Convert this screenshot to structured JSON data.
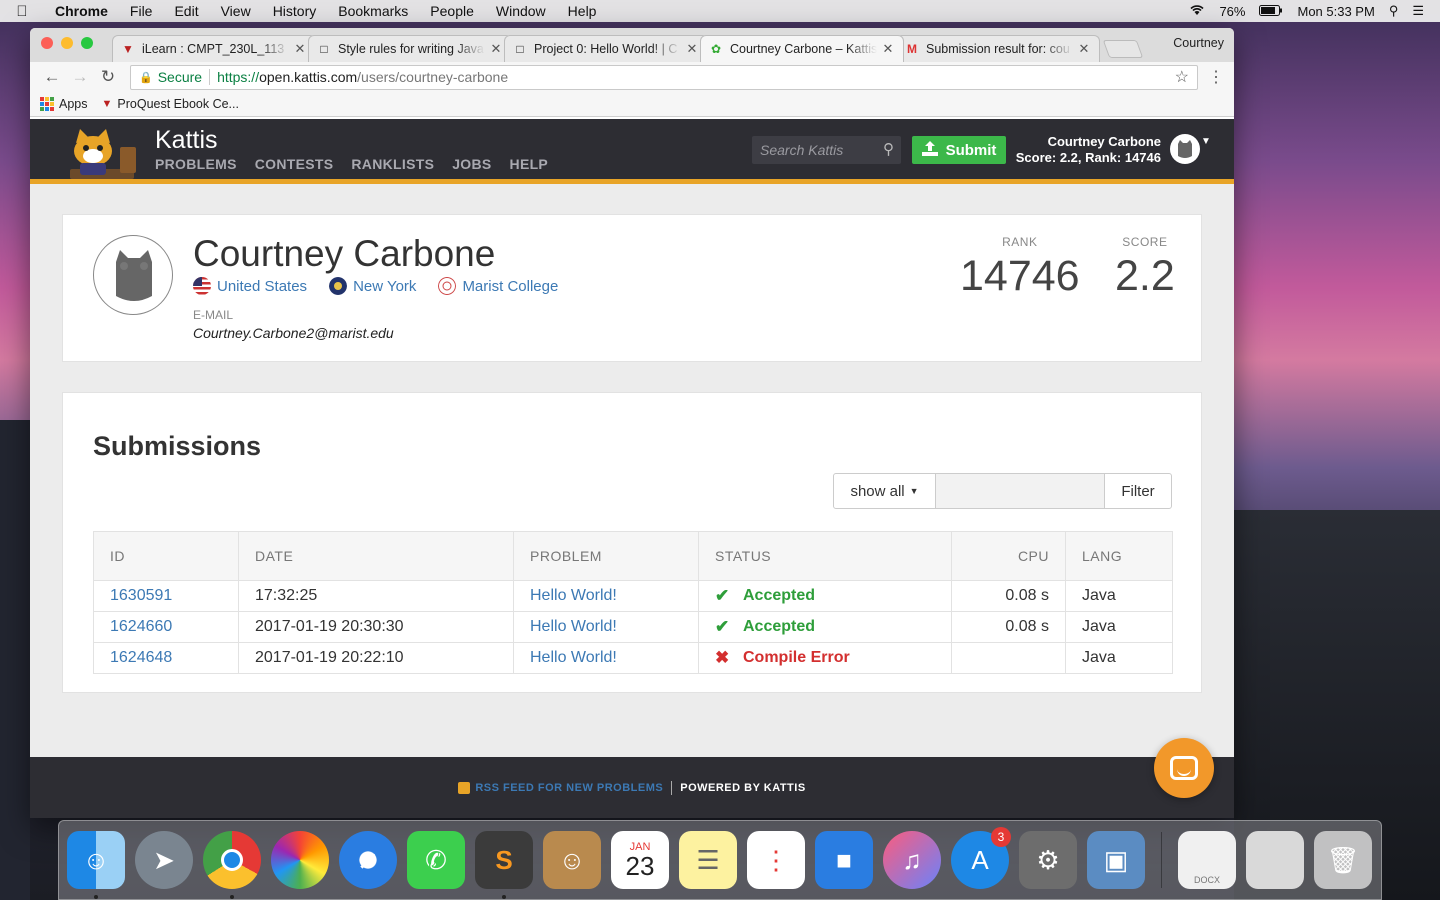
{
  "menubar": {
    "items": [
      "Chrome",
      "File",
      "Edit",
      "View",
      "History",
      "Bookmarks",
      "People",
      "Window",
      "Help"
    ],
    "battery": "76%",
    "clock": "Mon 5:33 PM"
  },
  "browser": {
    "tabs": [
      {
        "title": "iLearn : CMPT_230L_113"
      },
      {
        "title": "Style rules for writing Java"
      },
      {
        "title": "Project 0: Hello World! | C"
      },
      {
        "title": "Courtney Carbone – Kattis"
      },
      {
        "title": "Submission result for: cou"
      }
    ],
    "profile_name": "Courtney",
    "secure_label": "Secure",
    "url_scheme": "https://",
    "url_host": "open.kattis.com",
    "url_path": "/users/courtney-carbone",
    "bookmarks": [
      "Apps",
      "ProQuest Ebook Ce..."
    ]
  },
  "kattis": {
    "brand": "Kattis",
    "nav": [
      "PROBLEMS",
      "CONTESTS",
      "RANKLISTS",
      "JOBS",
      "HELP"
    ],
    "search_placeholder": "Search Kattis",
    "submit_label": "Submit",
    "user_name": "Courtney Carbone",
    "user_score": "Score: 2.2, Rank: 14746"
  },
  "profile": {
    "name": "Courtney Carbone",
    "country": "United States",
    "state": "New York",
    "school": "Marist College",
    "email_label": "E-MAIL",
    "email": "Courtney.Carbone2@marist.edu",
    "rank_label": "RANK",
    "rank": "14746",
    "score_label": "SCORE",
    "score": "2.2"
  },
  "submissions": {
    "title": "Submissions",
    "filter_select": "show all",
    "filter_button": "Filter",
    "headers": [
      "ID",
      "DATE",
      "PROBLEM",
      "STATUS",
      "CPU",
      "LANG"
    ],
    "rows": [
      {
        "id": "1630591",
        "date": "17:32:25",
        "problem": "Hello World!",
        "status": "Accepted",
        "cpu": "0.08 s",
        "lang": "Java"
      },
      {
        "id": "1624660",
        "date": "2017-01-19 20:30:30",
        "problem": "Hello World!",
        "status": "Accepted",
        "cpu": "0.08 s",
        "lang": "Java"
      },
      {
        "id": "1624648",
        "date": "2017-01-19 20:22:10",
        "problem": "Hello World!",
        "status": "Compile Error",
        "cpu": "",
        "lang": "Java"
      }
    ]
  },
  "footer": {
    "rss": "RSS FEED FOR NEW PROBLEMS",
    "powered": "POWERED BY KATTIS"
  },
  "dock": {
    "calendar_month": "JAN",
    "calendar_day": "23",
    "appstore_badge": "3",
    "docx_label": "DOCX"
  },
  "colors": {
    "accent_orange": "#e8a427",
    "submit_green": "#3cb84a",
    "link_blue": "#3c79b4",
    "ok_green": "#2e9e3a",
    "error_red": "#d32f2f"
  }
}
